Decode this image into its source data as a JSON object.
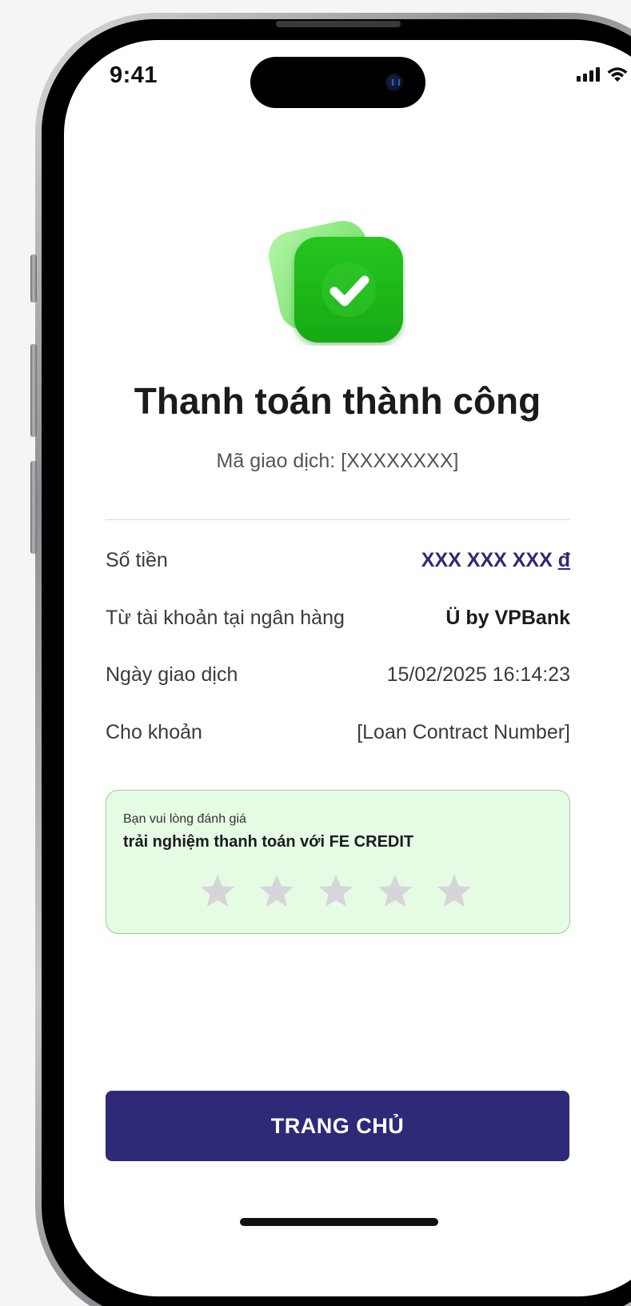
{
  "status_bar": {
    "time": "9:41",
    "signal_icon": "cellular-signal-icon",
    "wifi_icon": "wifi-icon",
    "battery_icon": "battery-icon",
    "battery_level": 1.0
  },
  "header": {
    "icon": "checkmark-success-icon",
    "title": "Thanh toán thành công",
    "transaction_code": "Mã giao dịch: [XXXXXXXX]"
  },
  "details": [
    {
      "label": "Số tiền",
      "value": "XXX XXX XXX ",
      "currency": "đ"
    },
    {
      "label": "Từ tài khoản tại ngân hàng",
      "value": "Ü by VPBank"
    },
    {
      "label": "Ngày giao dịch",
      "value": "15/02/2025 16:14:23"
    },
    {
      "label": "Cho khoản",
      "value": "[Loan Contract Number]"
    }
  ],
  "rating": {
    "prompt": "Bạn vui lòng đánh giá",
    "subject": "trải nghiệm thanh toán với FE CREDIT",
    "max_stars": 5,
    "selected_stars": 0,
    "star_icon": "star-icon"
  },
  "actions": {
    "home_label": "TRANG CHỦ"
  },
  "colors": {
    "primary": "#2E2A78",
    "success_green": "#1FB21A",
    "rating_bg": "#E6FBE3",
    "rating_border": "#9CCC93",
    "star_empty": "#D6D6DA"
  }
}
